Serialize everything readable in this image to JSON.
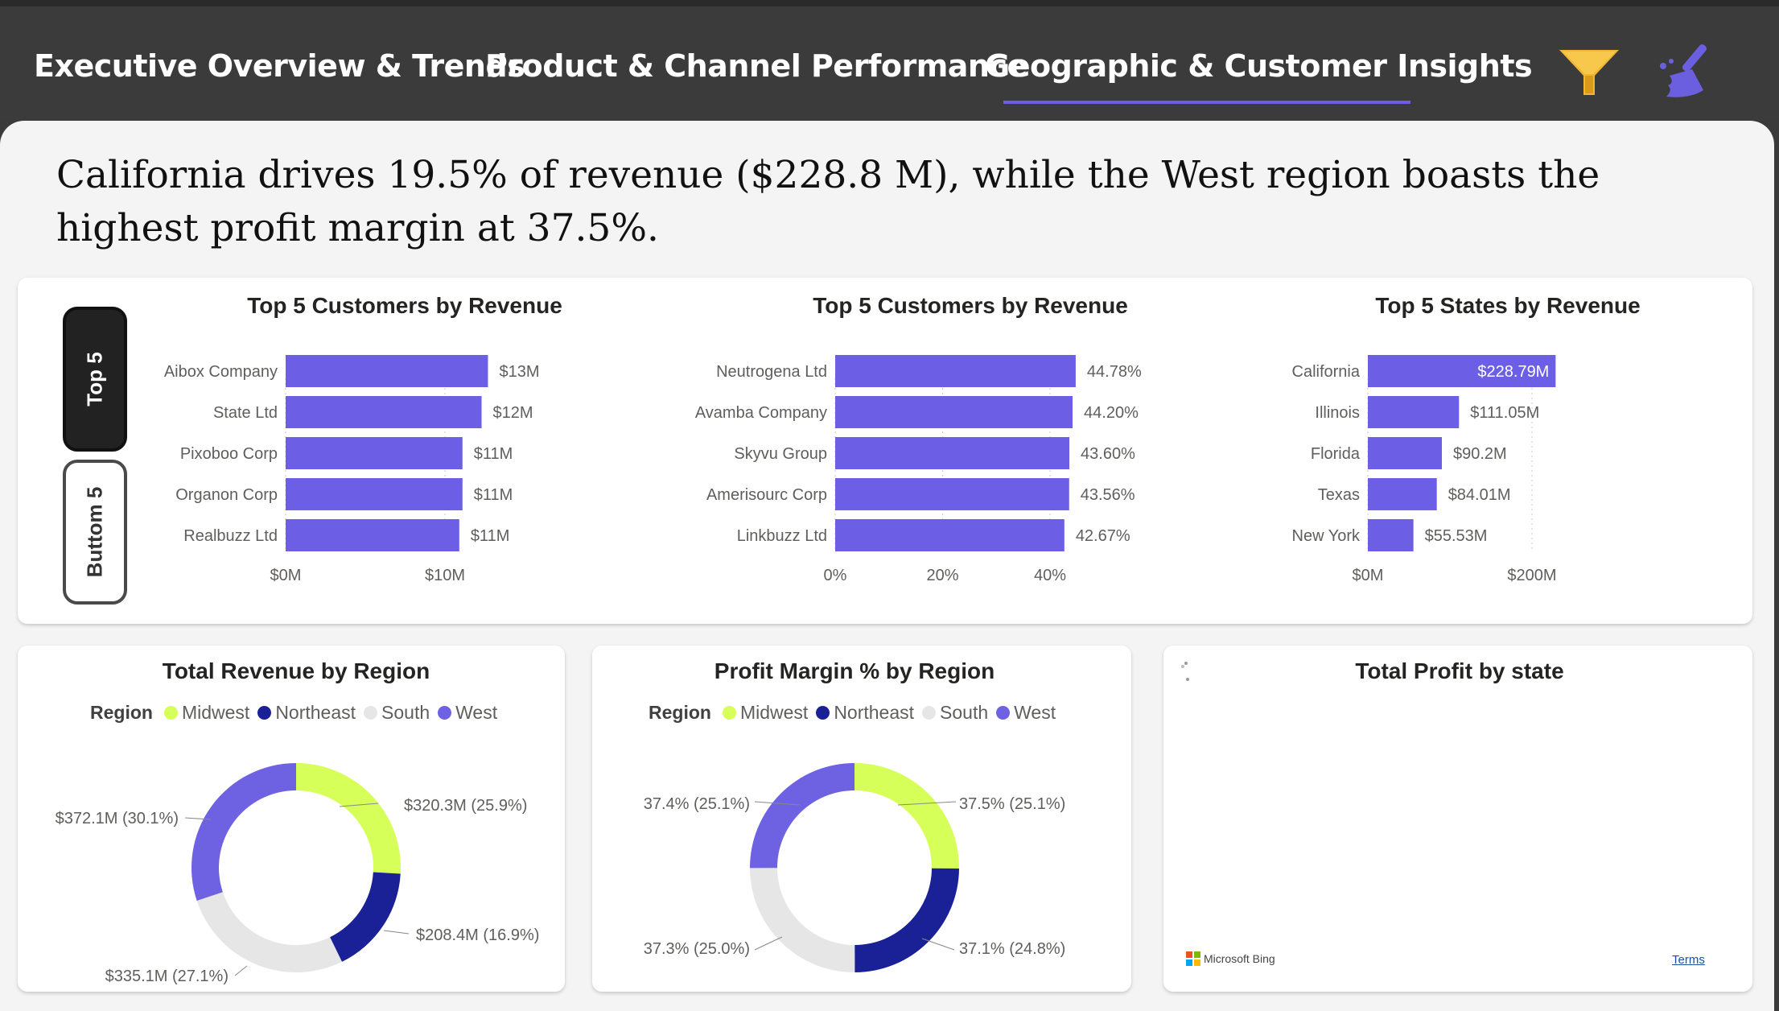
{
  "tabs": [
    {
      "label": "Executive Overview & Trends"
    },
    {
      "label": "Product & Channel Performance"
    },
    {
      "label": "Geographic & Customer Insights"
    }
  ],
  "active_tab": "Geographic & Customer Insights",
  "icons": {
    "filter": "funnel-icon",
    "clear": "broom-icon"
  },
  "colors": {
    "accent": "#6b5fe0",
    "bar": "#6c5fe6",
    "midwest": "#d6ff5a",
    "northeast": "#1a2196",
    "south": "#e6e6e6",
    "west": "#6e62e3"
  },
  "headline": "California drives 19.5% of revenue ($228.8 M), while the West region boasts the highest profit margin at 37.5%.",
  "toggle": {
    "top": "Top 5",
    "bottom": "Buttom 5"
  },
  "chart_data": [
    {
      "type": "bar",
      "title": "Top 5 Customers by Revenue",
      "categories": [
        "Aibox Company",
        "State Ltd",
        "Pixoboo Corp",
        "Organon Corp",
        "Realbuzz Ltd"
      ],
      "values": [
        12.7,
        12.3,
        11.1,
        11.1,
        10.9
      ],
      "data_labels": [
        "$13M",
        "$12M",
        "$11M",
        "$11M",
        "$11M"
      ],
      "xticks": [
        "$0M",
        "$10M"
      ],
      "xlim": [
        0,
        15
      ]
    },
    {
      "type": "bar",
      "title": "Top 5 Customers by Revenue",
      "categories": [
        "Neutrogena Ltd",
        "Avamba Company",
        "Skyvu Group",
        "Amerisourc Corp",
        "Linkbuzz Ltd"
      ],
      "values": [
        44.78,
        44.2,
        43.6,
        43.56,
        42.67
      ],
      "data_labels": [
        "44.78%",
        "44.20%",
        "43.60%",
        "43.56%",
        "42.67%"
      ],
      "xticks": [
        "0%",
        "20%",
        "40%"
      ],
      "xlim": [
        0,
        52
      ]
    },
    {
      "type": "bar",
      "title": "Top 5 States by Revenue",
      "categories": [
        "California",
        "Illinois",
        "Florida",
        "Texas",
        "New York"
      ],
      "values": [
        228.79,
        111.05,
        90.2,
        84.01,
        55.53
      ],
      "data_labels": [
        "$228.79M",
        "$111.05M",
        "$90.2M",
        "$84.01M",
        "$55.53M"
      ],
      "xticks": [
        "$0M",
        "$200M"
      ],
      "xlim": [
        0,
        250
      ]
    },
    {
      "type": "pie",
      "title": "Total Revenue by Region",
      "legend_title": "Region",
      "categories": [
        "Midwest",
        "Northeast",
        "South",
        "West"
      ],
      "values": [
        320.3,
        208.4,
        335.1,
        372.1
      ],
      "data_labels": [
        "$320.3M (25.9%)",
        "$208.4M (16.9%)",
        "$335.1M (27.1%)",
        "$372.1M (30.1%)"
      ]
    },
    {
      "type": "pie",
      "title": "Profit Margin % by Region",
      "legend_title": "Region",
      "categories": [
        "Midwest",
        "Northeast",
        "South",
        "West"
      ],
      "values": [
        37.5,
        37.1,
        37.3,
        37.4
      ],
      "data_labels": [
        "37.5% (25.1%)",
        "37.1% (24.8%)",
        "37.3% (25.0%)",
        "37.4% (25.1%)"
      ]
    }
  ],
  "map": {
    "title": "Total Profit by state",
    "brand": "Microsoft Bing",
    "terms": "Terms"
  }
}
